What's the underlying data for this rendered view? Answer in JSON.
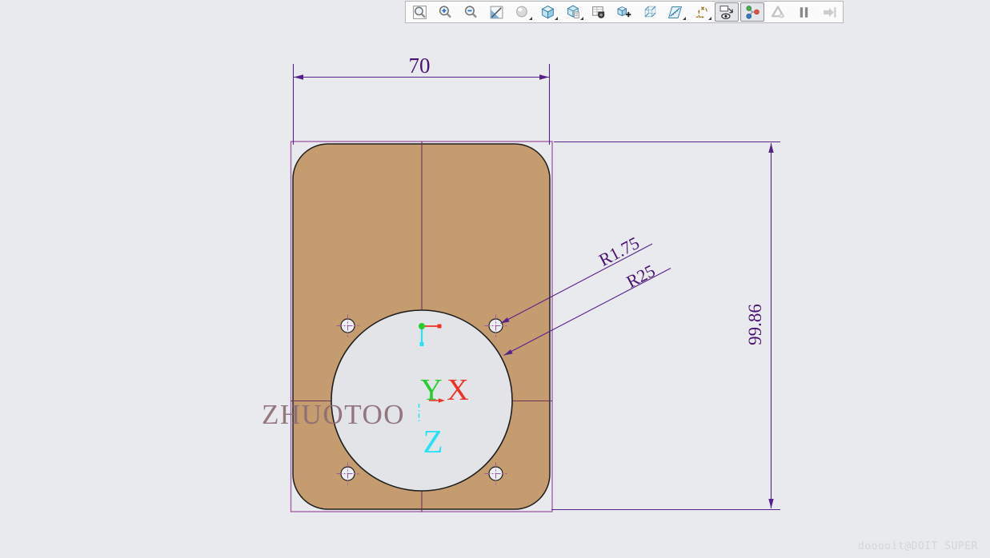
{
  "toolbar": {
    "icons": [
      "zoom-window-icon",
      "zoom-in-icon",
      "zoom-out-icon",
      "zoom-fit-icon",
      "shaded-render-icon",
      "isometric-cube-icon",
      "view-orientation-icon",
      "view-table-camera-icon",
      "add-view-cube-icon",
      "wireframe-cube-icon",
      "section-plane-icon",
      "sketch-axes-icon",
      "display-filter-eye-icon",
      "assembly-node-graph-icon",
      "triangle-play-icon",
      "pause-icon",
      "step-into-icon"
    ],
    "pressed_icons": [
      "display-filter-eye-icon",
      "assembly-node-graph-icon"
    ],
    "disabled_icons": [
      "triangle-play-icon",
      "step-into-icon"
    ]
  },
  "drawing": {
    "dimensions": {
      "width": "70",
      "height": "99.86",
      "hole_radius": "R1.75",
      "bore_radius": "R25"
    },
    "axis_labels": {
      "x": "X",
      "y": "Y",
      "z": "Z"
    },
    "watermark": "ZHUOTOO",
    "footer_watermark": "dooooit@DOIT SUPER",
    "colors": {
      "canvas_bg": "#e9eaed",
      "plate_fill": "#c59b70",
      "plate_outline": "#1e1e1e",
      "sketch_rect": "#a257a2",
      "dimension_line": "#55218a",
      "dimension_text": "#4a1272",
      "centerline": "#6e3355",
      "crosshair": "#9b57a0",
      "bore_fill": "#e2e4e8",
      "hole_fill": "#edeef1",
      "axis_x": "#ee3228",
      "axis_y": "#27cd2f",
      "axis_z": "#25e2f5",
      "watermark": "#8d6d74",
      "footer_watermark": "#d4d5d8"
    }
  }
}
